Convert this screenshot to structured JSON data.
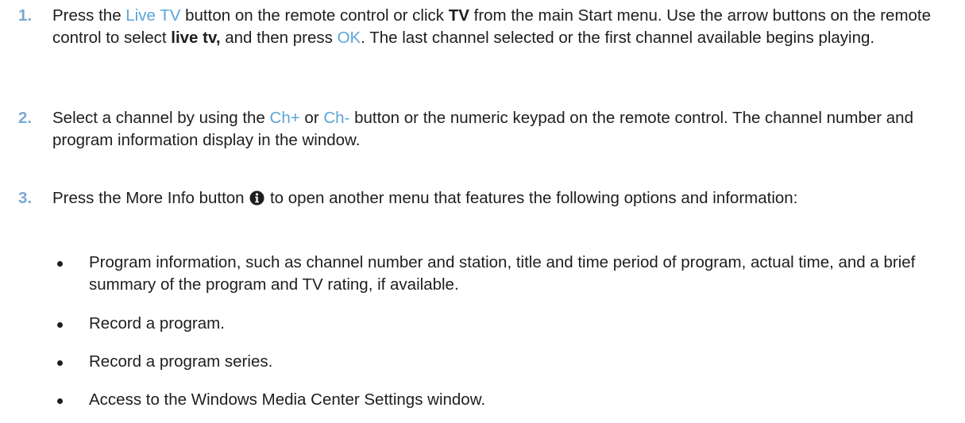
{
  "steps": [
    {
      "number": "1.",
      "parts": {
        "a": "Press the ",
        "b": "Live TV",
        "c": " button on the remote control or click ",
        "d": "TV",
        "e": " from the main Start menu. Use the arrow buttons on the remote control to select ",
        "f": "live tv,",
        "g": " and then press ",
        "h": "OK",
        "i": ". The last channel selected or the first channel available begins playing."
      }
    },
    {
      "number": "2.",
      "parts": {
        "a": "Select a channel by using the ",
        "b": "Ch+",
        "c": " or ",
        "d": "Ch-",
        "e": " button or the numeric keypad on the remote control. The channel number and program information display in the window."
      }
    },
    {
      "number": "3.",
      "parts": {
        "a": "Press the More Info button ",
        "b": " to open another menu that features the following options and information:"
      }
    }
  ],
  "bullets": [
    "Program information, such as channel number and station, title and time period of program, actual time, and a brief summary of the program and TV rating, if available.",
    "Record a program.",
    "Record a program series.",
    "Access to the Windows Media Center Settings window."
  ],
  "icons": {
    "more_info": "info-icon"
  },
  "colors": {
    "step_number": "#7ba9cf",
    "highlight": "#5aa5d8",
    "text": "#1e1e1e"
  }
}
